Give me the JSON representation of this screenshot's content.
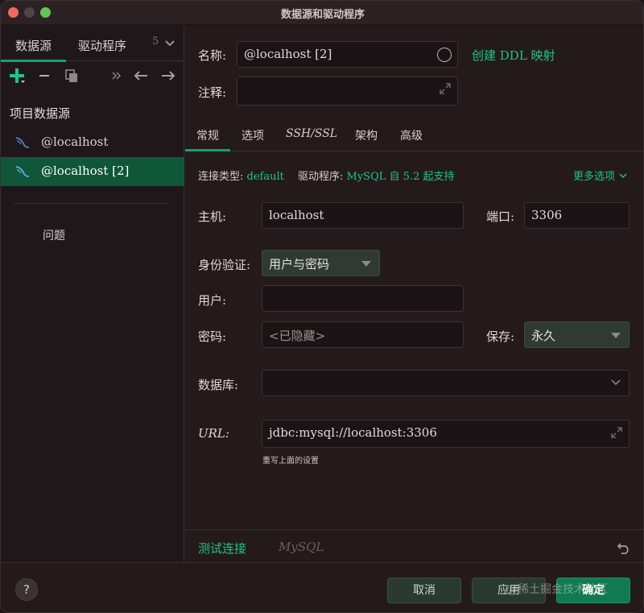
{
  "window": {
    "title": "数据源和驱动程序"
  },
  "left": {
    "tabs": [
      {
        "label": "数据源",
        "active": true
      },
      {
        "label": "驱动程序",
        "active": false
      }
    ],
    "tab_overflow": "5",
    "section_title": "项目数据源",
    "data_sources": [
      {
        "label": "@localhost",
        "selected": false,
        "icon": "mysql-dolphin-icon"
      },
      {
        "label": "@localhost [2]",
        "selected": true,
        "icon": "mysql-dolphin-icon"
      }
    ],
    "problems_label": "问题"
  },
  "form": {
    "name_label": "名称:",
    "name_value": "@localhost [2]",
    "create_ddl_link": "创建 DDL 映射",
    "comment_label": "注释:",
    "comment_value": "",
    "tabs": [
      {
        "label": "常规",
        "active": true
      },
      {
        "label": "选项",
        "active": false
      },
      {
        "label": "SSH/SSL",
        "active": false
      },
      {
        "label": "架构",
        "active": false
      },
      {
        "label": "高级",
        "active": false
      }
    ],
    "conn_type_label": "连接类型:",
    "conn_type_value": "default",
    "driver_label": "驱动程序:",
    "driver_value": "MySQL",
    "driver_note": "自 5.2 起支持",
    "more_options": "更多选项",
    "host_label": "主机:",
    "host_value": "localhost",
    "port_label": "端口:",
    "port_value": "3306",
    "auth_label": "身份验证:",
    "auth_value": "用户与密码",
    "user_label": "用户:",
    "user_value": "",
    "password_label": "密码:",
    "password_placeholder": "<已隐藏>",
    "save_label": "保存:",
    "save_value": "永久",
    "database_label": "数据库:",
    "database_value": "",
    "url_label": "URL:",
    "url_value": "jdbc:mysql://localhost:3306",
    "url_note": "重写上面的设置",
    "test_connection": "测试连接",
    "driver_name_dim": "MySQL"
  },
  "footer": {
    "help": "?",
    "cancel": "取消",
    "apply": "应用",
    "ok": "确定",
    "watermark": "@稀土掘金技术社区"
  },
  "colors": {
    "accent": "#20c38a",
    "selection": "#10573a",
    "background": "#241a1c"
  }
}
